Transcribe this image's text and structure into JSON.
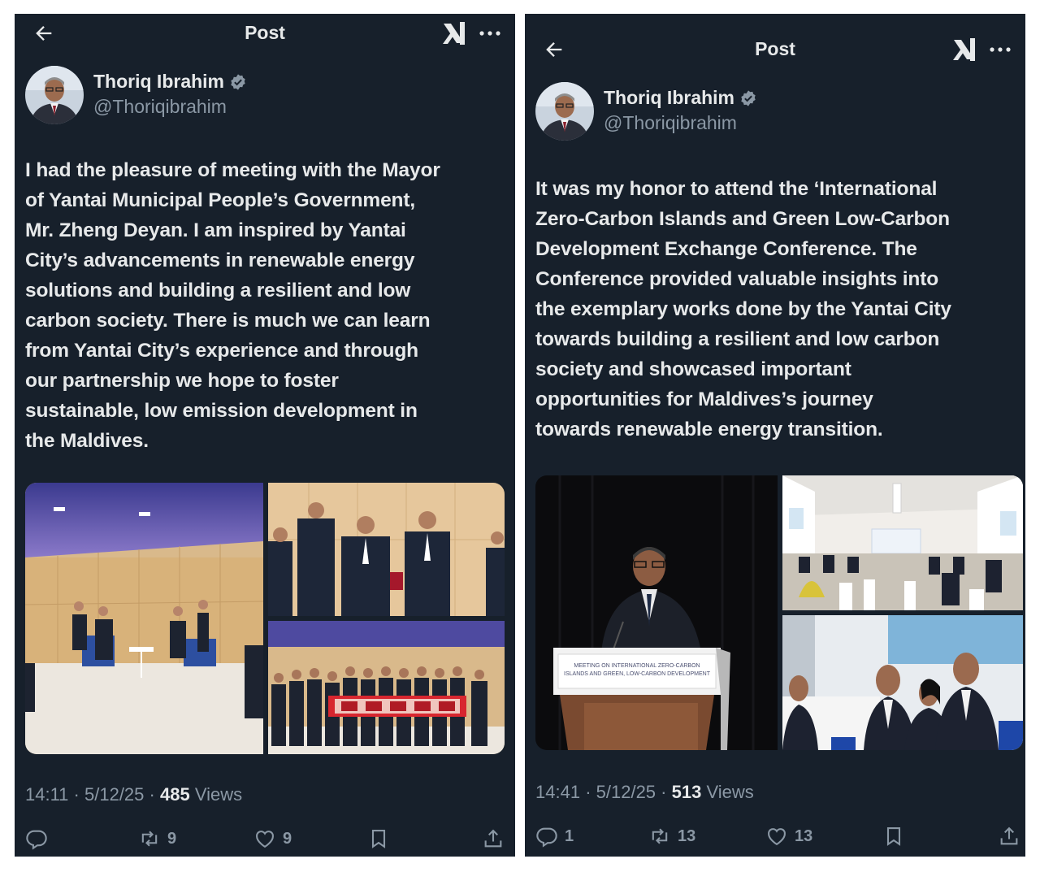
{
  "left_post": {
    "header": {
      "title": "Post",
      "icons": [
        "back-arrow-icon",
        "grok-icon",
        "more-icon"
      ]
    },
    "author": {
      "name": "Thoriq Ibrahim",
      "handle": "@Thoriqibrahim",
      "verified": true
    },
    "text": "I had the pleasure of meeting with the Mayor\nof Yantai Municipal People’s Government,\nMr. Zheng Deyan.  I am inspired by Yantai\nCity’s advancements in renewable energy\nsolutions and building a resilient and low\ncarbon society. There is much we can learn\nfrom Yantai City’s experience and through\nour partnership we hope to foster\nsustainable, low emission development in\nthe Maldives.",
    "meta": {
      "time": "14:11",
      "date": "5/12/25",
      "views_count": "485",
      "views_label": "Views",
      "separator": "·"
    },
    "actions": {
      "replies": "",
      "reposts": "9",
      "likes": "9"
    }
  },
  "right_post": {
    "header": {
      "title": "Post",
      "icons": [
        "back-arrow-icon",
        "grok-icon",
        "more-icon"
      ]
    },
    "author": {
      "name": "Thoriq Ibrahim",
      "handle": "@Thoriqibrahim",
      "verified": true
    },
    "text": "It was my honor to attend the ‘International\nZero-Carbon Islands and Green Low-Carbon\nDevelopment Exchange Conference. The\nConference provided valuable insights into\nthe exemplary works done by the Yantai City\ntowards building a resilient and low carbon\nsociety and showcased important\nopportunities for Maldives’s journey\ntowards renewable energy transition.",
    "podium_sign": "MEETING ON INTERNATIONAL ZERO-CARBON\nISLANDS AND GREEN, LOW-CARBON DEVELOPMENT",
    "meta": {
      "time": "14:41",
      "date": "5/12/25",
      "views_count": "513",
      "views_label": "Views",
      "separator": "·"
    },
    "actions": {
      "replies": "1",
      "reposts": "13",
      "likes": "13"
    }
  },
  "colors": {
    "background": "#17202b",
    "text_primary": "#e7e9ea",
    "text_secondary": "#8b98a5",
    "verified_badge": "#8b98a5"
  }
}
